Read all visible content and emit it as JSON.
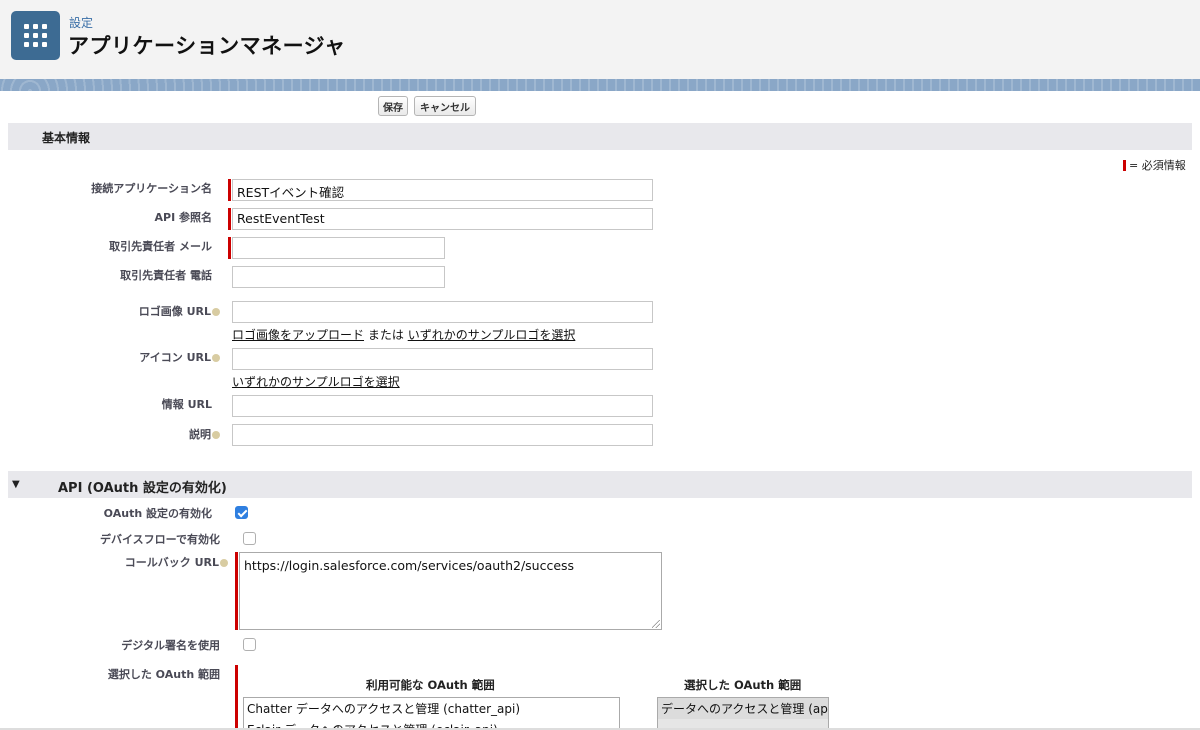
{
  "header": {
    "breadcrumb": "設定",
    "title": "アプリケーションマネージャ",
    "icon": "app-grid-icon"
  },
  "toolbar": {
    "save_label": "保存",
    "cancel_label": "キャンセル"
  },
  "basic_info": {
    "section_title": "基本情報",
    "required_legend": "= 必須情報",
    "fields": {
      "app_name": {
        "label": "接続アプリケーション名",
        "value": "RESTイベント確認"
      },
      "api_name": {
        "label": "API 参照名",
        "value": "RestEventTest"
      },
      "contact_email": {
        "label": "取引先責任者 メール",
        "value": ""
      },
      "contact_phone": {
        "label": "取引先責任者 電話",
        "value": ""
      },
      "logo_url": {
        "label": "ロゴ画像 URL",
        "value": "",
        "upload_link": "ロゴ画像をアップロード",
        "or_text": "または",
        "sample_link": "いずれかのサンプルロゴを選択"
      },
      "icon_url": {
        "label": "アイコン URL",
        "value": "",
        "sample_link": "いずれかのサンプルロゴを選択"
      },
      "info_url": {
        "label": "情報 URL",
        "value": ""
      },
      "description": {
        "label": "説明",
        "value": ""
      }
    }
  },
  "api_section": {
    "section_title": "API (OAuth 設定の有効化)",
    "oauth_enabled": {
      "label": "OAuth 設定の有効化",
      "checked": true
    },
    "device_flow": {
      "label": "デバイスフローで有効化",
      "checked": false
    },
    "callback_url": {
      "label": "コールバック URL",
      "value": "https://login.salesforce.com/services/oauth2/success"
    },
    "digital_signature": {
      "label": "デジタル署名を使用",
      "checked": false
    },
    "scopes": {
      "label": "選択した OAuth 範囲",
      "available_title": "利用可能な OAuth 範囲",
      "selected_title": "選択した OAuth 範囲",
      "available": [
        "Chatter データへのアクセスと管理 (chatter_api)",
        "Eclair データへのアクセスと管理 (eclair_api)"
      ],
      "selected": [
        "データへのアクセスと管理 (api)"
      ]
    }
  },
  "colors": {
    "required": "#cc0000",
    "checkbox_on": "#2f7fe0",
    "app_icon_bg": "#3d6b93",
    "band": "#8aa7c7"
  }
}
